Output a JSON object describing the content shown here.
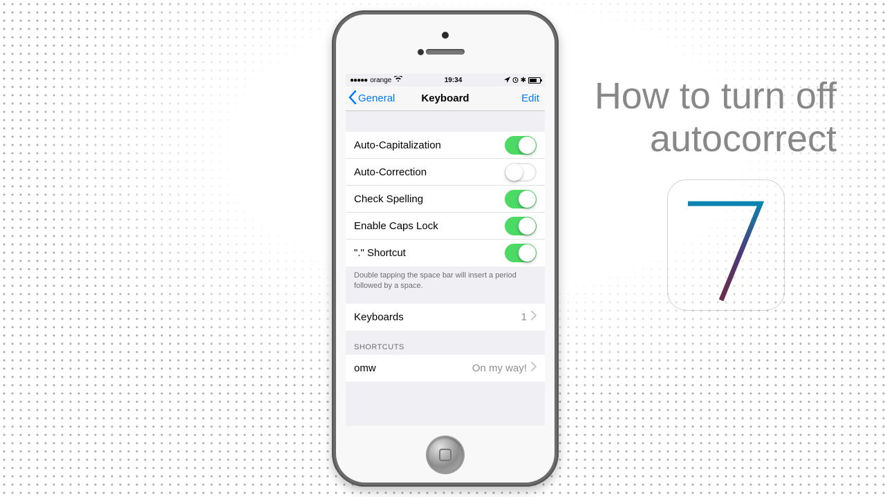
{
  "overlay": {
    "line1": "How to turn off",
    "line2": "autocorrect"
  },
  "status": {
    "carrier": "orange",
    "time": "19:34"
  },
  "nav": {
    "back_label": "General",
    "title": "Keyboard",
    "edit_label": "Edit"
  },
  "settings": {
    "auto_cap_label": "Auto-Capitalization",
    "auto_correct_label": "Auto-Correction",
    "check_spelling_label": "Check Spelling",
    "caps_lock_label": "Enable Caps Lock",
    "dot_shortcut_label": "\".\" Shortcut",
    "footer": "Double tapping the space bar will insert a period followed by a space."
  },
  "keyboards": {
    "label": "Keyboards",
    "count": "1"
  },
  "shortcuts": {
    "header": "SHORTCUTS",
    "items": [
      {
        "key": "omw",
        "value": "On my way!"
      }
    ]
  },
  "toggles": {
    "auto_cap": true,
    "auto_correct": false,
    "check_spelling": true,
    "caps_lock": true,
    "dot_shortcut": true
  }
}
